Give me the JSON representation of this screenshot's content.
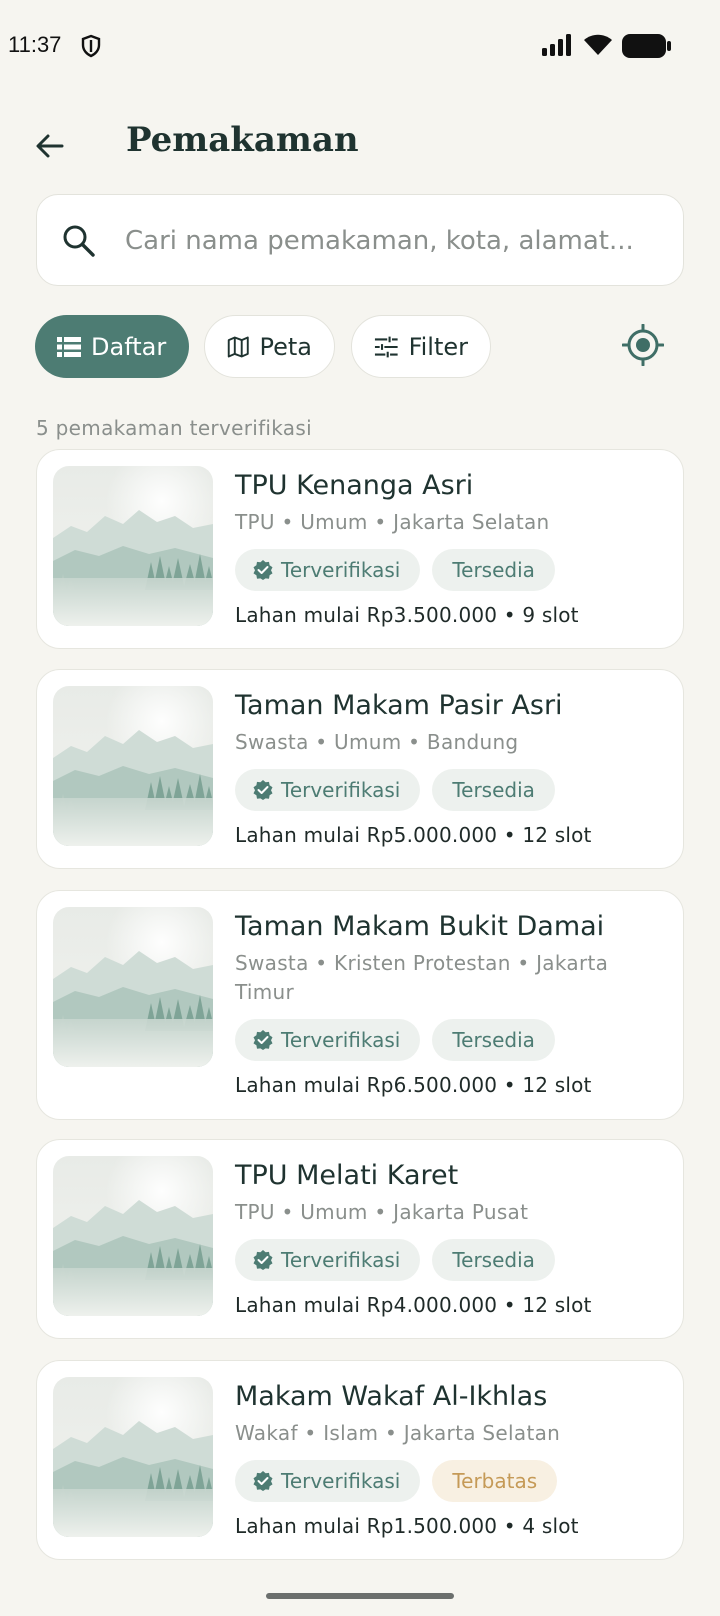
{
  "status_bar": {
    "time": "11:37"
  },
  "header": {
    "title": "Pemakaman"
  },
  "search": {
    "placeholder": "Cari nama pemakaman, kota, alamat..."
  },
  "view_toggle": {
    "list_label": "Daftar",
    "map_label": "Peta",
    "filter_label": "Filter"
  },
  "result_count": "5 pemakaman terverifikasi",
  "colors": {
    "primary": "#4d7c73",
    "background": "#f6f5f0",
    "badge_verified_bg": "#edf1ee",
    "badge_limited_bg": "#f8f0e2",
    "badge_limited_text": "#c59a57"
  },
  "cemeteries": [
    {
      "name": "TPU Kenanga Asri",
      "meta": "TPU • Umum • Jakarta Selatan",
      "verified_label": "Terverifikasi",
      "availability": "Tersedia",
      "availability_type": "available",
      "price": "Lahan mulai Rp3.500.000 • 9 slot"
    },
    {
      "name": "Taman Makam Pasir Asri",
      "meta": "Swasta • Umum • Bandung",
      "verified_label": "Terverifikasi",
      "availability": "Tersedia",
      "availability_type": "available",
      "price": "Lahan mulai Rp5.000.000 • 12 slot"
    },
    {
      "name": "Taman Makam Bukit Damai",
      "meta": "Swasta • Kristen Protestan • Jakarta Timur",
      "verified_label": "Terverifikasi",
      "availability": "Tersedia",
      "availability_type": "available",
      "price": "Lahan mulai Rp6.500.000 • 12 slot"
    },
    {
      "name": "TPU Melati Karet",
      "meta": "TPU • Umum • Jakarta Pusat",
      "verified_label": "Terverifikasi",
      "availability": "Tersedia",
      "availability_type": "available",
      "price": "Lahan mulai Rp4.000.000 • 12 slot"
    },
    {
      "name": "Makam Wakaf Al-Ikhlas",
      "meta": "Wakaf • Islam • Jakarta Selatan",
      "verified_label": "Terverifikasi",
      "availability": "Terbatas",
      "availability_type": "limited",
      "price": "Lahan mulai Rp1.500.000 • 4 slot"
    }
  ]
}
